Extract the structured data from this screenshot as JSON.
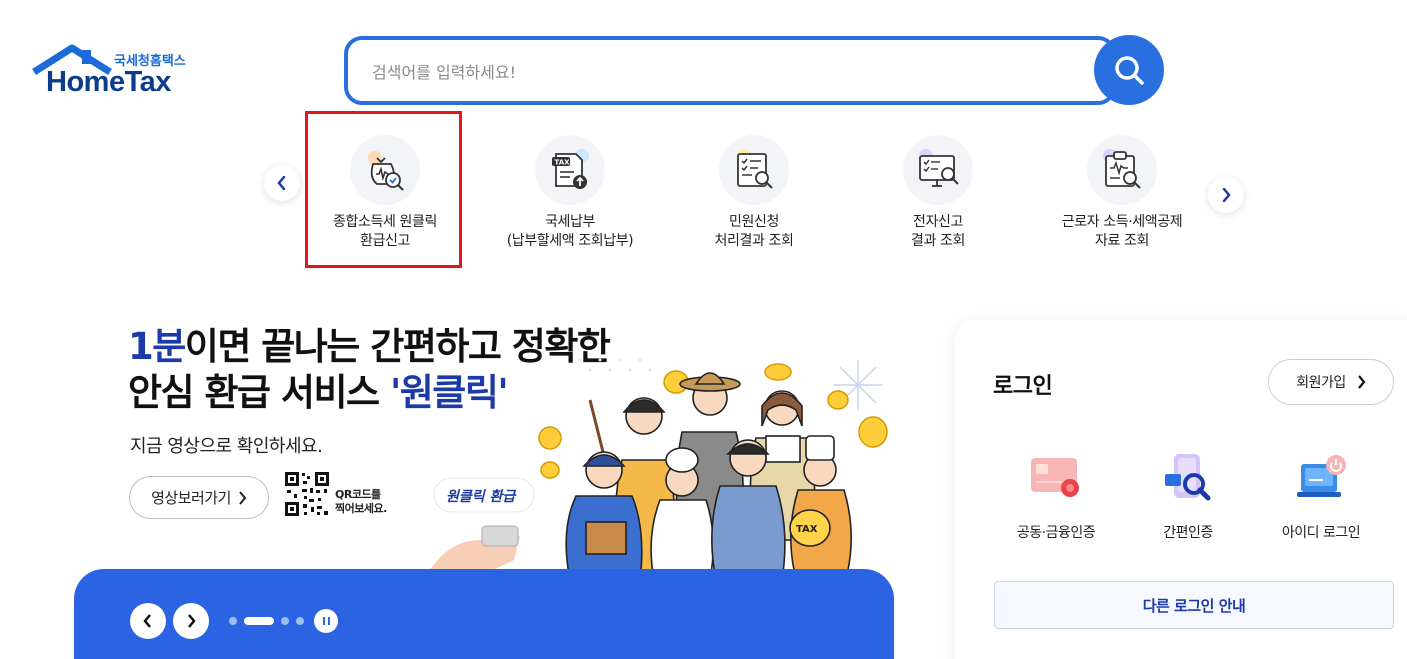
{
  "logo": {
    "sub": "국세청홈택스",
    "main": "HomeTax"
  },
  "search": {
    "placeholder": "검색어를 입력하세요!"
  },
  "quick_menu": {
    "items": [
      {
        "label": "종합소득세 원클릭\n환급신고",
        "icon": "money-bag-search-icon"
      },
      {
        "label": "국세납부\n(납부할세액 조회납부)",
        "icon": "tax-document-upload-icon"
      },
      {
        "label": "민원신청\n처리결과 조회",
        "icon": "document-search-icon"
      },
      {
        "label": "전자신고\n결과 조회",
        "icon": "monitor-search-icon"
      },
      {
        "label": "근로자 소득·세액공제\n자료 조회",
        "icon": "clipboard-search-icon"
      }
    ]
  },
  "banner": {
    "title_accent_1": "1분",
    "title_line1_rest": "이면 끝나는 간편하고 정확한",
    "title_line2_start": "안심 환급 서비스 ",
    "title_accent_2": "'원클릭'",
    "subtitle": "지금 영상으로 확인하세요.",
    "video_button": "영상보러가기",
    "qr_text": "QR코드를\n찍어보세요.",
    "button_graphic_text": "원클릭 환급",
    "coin_text": "TAX"
  },
  "carousel": {
    "slide_count": 4,
    "active_index": 1
  },
  "login": {
    "title": "로그인",
    "signup": "회원가입",
    "options": [
      {
        "label": "공동·금융인증",
        "icon": "certificate-card-icon"
      },
      {
        "label": "간편인증",
        "icon": "phone-search-icon"
      },
      {
        "label": "아이디 로그인",
        "icon": "laptop-power-icon"
      }
    ],
    "other": "다른 로그인 안내"
  },
  "colors": {
    "brand_blue": "#2a6fe0",
    "banner_blue": "#2b64e3",
    "accent_navy": "#1c3aa8",
    "highlight_red": "#e01a1a"
  }
}
